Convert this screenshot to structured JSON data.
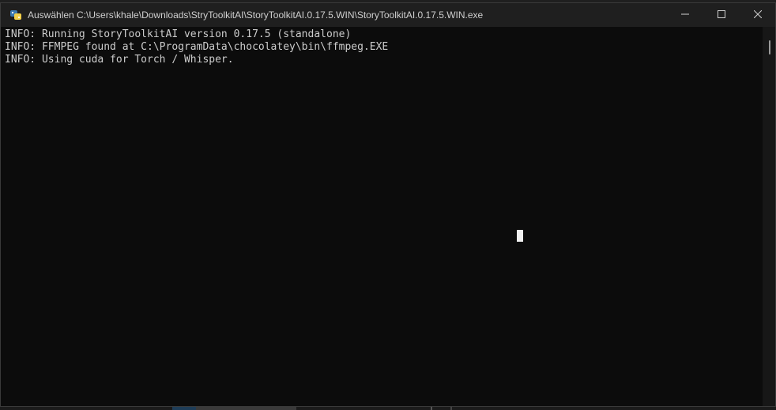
{
  "window": {
    "title": "Auswählen C:\\Users\\khale\\Downloads\\StryToolkitAI\\StoryToolkitAI.0.17.5.WIN\\StoryToolkitAI.0.17.5.WIN.exe",
    "icon": "python-app-icon",
    "controls": {
      "minimize": "minimize-icon",
      "maximize": "maximize-icon",
      "close": "close-icon"
    }
  },
  "console": {
    "lines": [
      "INFO: Running StoryToolkitAI version 0.17.5 (standalone)",
      "INFO: FFMPEG found at C:\\ProgramData\\chocolatey\\bin\\ffmpeg.EXE",
      "INFO: Using cuda for Torch / Whisper."
    ],
    "background_color": "#0c0c0c",
    "text_color": "#cccccc"
  }
}
